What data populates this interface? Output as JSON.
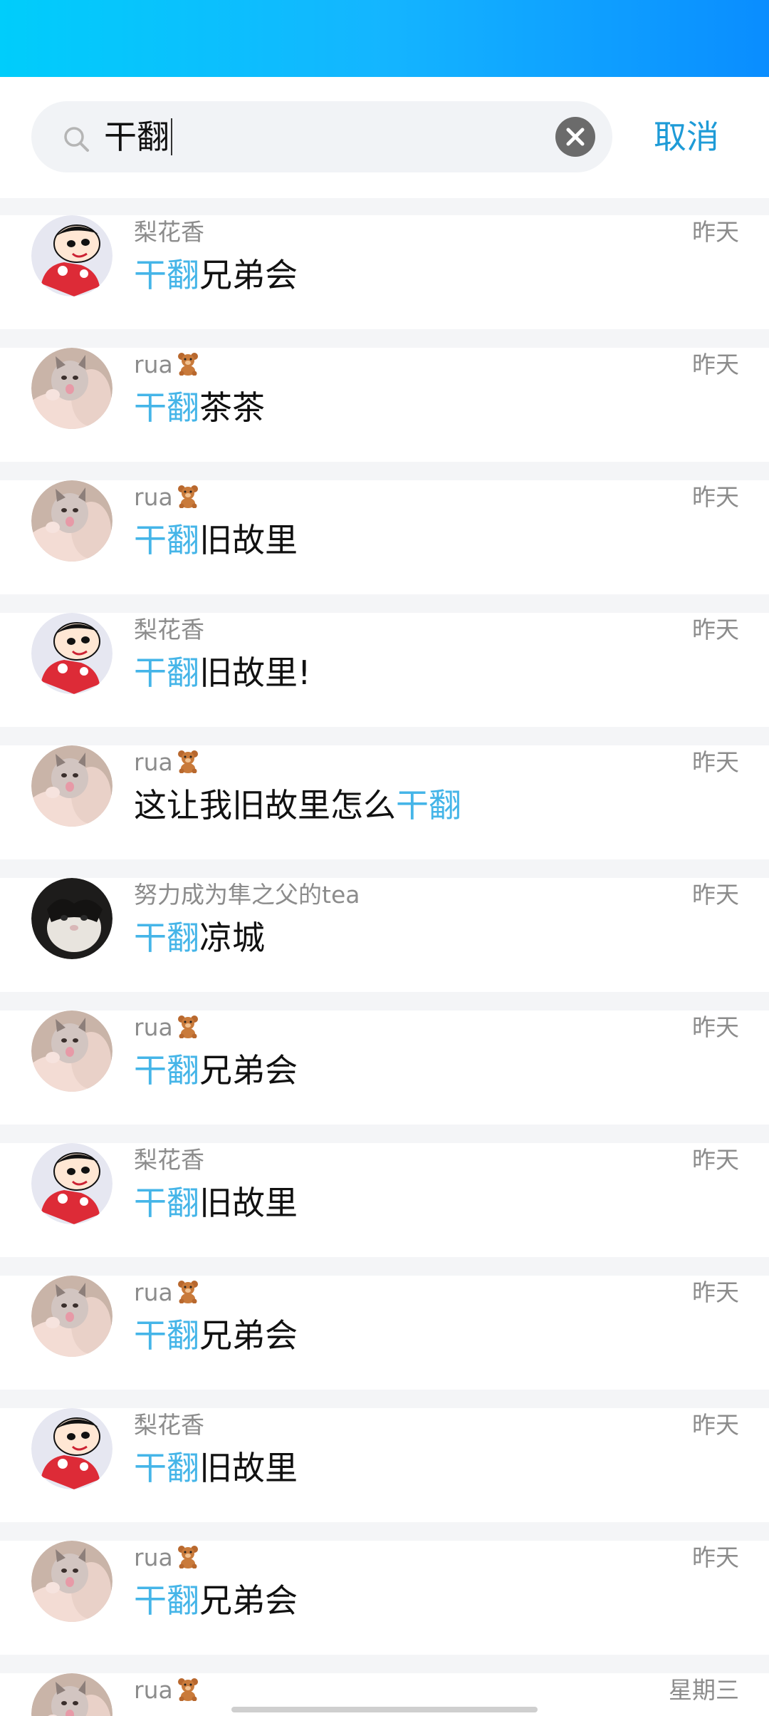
{
  "search": {
    "query": "干翻",
    "cancel_label": "取消"
  },
  "results": [
    {
      "sender": "梨花香",
      "avatar": "shinchan-avatar",
      "time": "昨天",
      "pre": "",
      "hl": "干翻",
      "post": "兄弟会"
    },
    {
      "sender": "rua",
      "sender_emoji": "teddy-bear",
      "avatar": "kitten-avatar",
      "time": "昨天",
      "pre": "",
      "hl": "干翻",
      "post": "茶茶"
    },
    {
      "sender": "rua",
      "sender_emoji": "teddy-bear",
      "avatar": "kitten-avatar",
      "time": "昨天",
      "pre": "",
      "hl": "干翻",
      "post": "旧故里"
    },
    {
      "sender": "梨花香",
      "avatar": "shinchan-avatar",
      "time": "昨天",
      "pre": "",
      "hl": "干翻",
      "post": "旧故里!"
    },
    {
      "sender": "rua",
      "sender_emoji": "teddy-bear",
      "avatar": "kitten-avatar",
      "time": "昨天",
      "pre": "这让我旧故里怎么",
      "hl": "干翻",
      "post": ""
    },
    {
      "sender": "努力成为隼之父的tea",
      "avatar": "black-white-cat-avatar",
      "time": "昨天",
      "pre": "",
      "hl": "干翻",
      "post": "凉城"
    },
    {
      "sender": "rua",
      "sender_emoji": "teddy-bear",
      "avatar": "kitten-avatar",
      "time": "昨天",
      "pre": "",
      "hl": "干翻",
      "post": "兄弟会"
    },
    {
      "sender": "梨花香",
      "avatar": "shinchan-avatar",
      "time": "昨天",
      "pre": "",
      "hl": "干翻",
      "post": "旧故里"
    },
    {
      "sender": "rua",
      "sender_emoji": "teddy-bear",
      "avatar": "kitten-avatar",
      "time": "昨天",
      "pre": "",
      "hl": "干翻",
      "post": "兄弟会"
    },
    {
      "sender": "梨花香",
      "avatar": "shinchan-avatar",
      "time": "昨天",
      "pre": "",
      "hl": "干翻",
      "post": "旧故里"
    },
    {
      "sender": "rua",
      "sender_emoji": "teddy-bear",
      "avatar": "kitten-avatar",
      "time": "昨天",
      "pre": "",
      "hl": "干翻",
      "post": "兄弟会"
    },
    {
      "sender": "rua",
      "sender_emoji": "teddy-bear",
      "avatar": "kitten-avatar",
      "time": "星期三",
      "pre": "",
      "hl": "",
      "post": ""
    }
  ],
  "colors": {
    "highlight": "#45b5e8",
    "cancel": "#1e9bd7",
    "header_gradient_start": "#00cdfb",
    "header_gradient_end": "#0a8dff"
  }
}
